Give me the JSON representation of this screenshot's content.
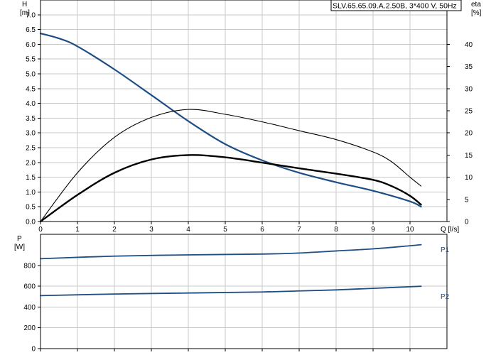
{
  "title": "SLV.65.65.09.A.2.50B, 3*400 V, 50Hz",
  "colors": {
    "head": "#1f4e84",
    "power": "#1f4e84",
    "efficiency": "#000000",
    "grid": "#c8c8c8"
  },
  "chart_data": [
    {
      "type": "line",
      "name": "head-efficiency",
      "x_label": "Q [l/s]",
      "y_label": "H",
      "y_unit": "[m]",
      "y2_label": "eta",
      "y2_unit": "[%]",
      "xlim": [
        0,
        11
      ],
      "ylim": [
        0,
        7.5
      ],
      "y2lim": [
        0,
        50
      ],
      "x_ticks": [
        "0",
        "1",
        "2",
        "3",
        "4",
        "5",
        "6",
        "7",
        "8",
        "9",
        "10"
      ],
      "y_ticks": [
        "0.0",
        "0.5",
        "1.0",
        "1.5",
        "2.0",
        "2.5",
        "3.0",
        "3.5",
        "4.0",
        "4.5",
        "5.0",
        "5.5",
        "6.0",
        "6.5",
        "7.0"
      ],
      "y2_ticks": [
        "0",
        "5",
        "10",
        "15",
        "20",
        "25",
        "30",
        "35",
        "40"
      ],
      "series": [
        {
          "key": "head",
          "axis": "y",
          "x": [
            0,
            0.5,
            1,
            2,
            3,
            4,
            5,
            6,
            7,
            8,
            9,
            10,
            10.3
          ],
          "y": [
            6.37,
            6.2,
            5.93,
            5.15,
            4.28,
            3.4,
            2.62,
            2.07,
            1.65,
            1.33,
            1.04,
            0.68,
            0.5
          ]
        },
        {
          "key": "eta_thin",
          "axis": "y2",
          "x": [
            0,
            1,
            2,
            3,
            4,
            5,
            6,
            7,
            8,
            9,
            9.5,
            10,
            10.3
          ],
          "y": [
            0,
            11,
            19,
            23.5,
            25.3,
            24.2,
            22.5,
            20.5,
            18.5,
            15.7,
            13.5,
            10,
            8
          ]
        },
        {
          "key": "eta_thick",
          "axis": "y2",
          "x": [
            0,
            1,
            2,
            3,
            4,
            5,
            6,
            7,
            8,
            9,
            9.5,
            10,
            10.3
          ],
          "y": [
            0,
            6,
            11,
            14,
            15,
            14.5,
            13.3,
            12,
            10.8,
            9.4,
            8,
            5.8,
            3.8
          ]
        }
      ]
    },
    {
      "type": "line",
      "name": "power",
      "y_label": "P",
      "y_unit": "[W]",
      "xlim": [
        0,
        11
      ],
      "ylim": [
        0,
        1100
      ],
      "y_ticks": [
        "0",
        "200",
        "400",
        "600",
        "800"
      ],
      "series": [
        {
          "name": "P1",
          "x": [
            0,
            2,
            4,
            6,
            7,
            8,
            9,
            10,
            10.3
          ],
          "y": [
            865,
            890,
            902,
            910,
            920,
            940,
            960,
            990,
            1000
          ]
        },
        {
          "name": "P2",
          "x": [
            0,
            2,
            4,
            6,
            7,
            8,
            9,
            10,
            10.3
          ],
          "y": [
            510,
            525,
            535,
            545,
            555,
            565,
            580,
            595,
            600
          ]
        }
      ]
    }
  ]
}
